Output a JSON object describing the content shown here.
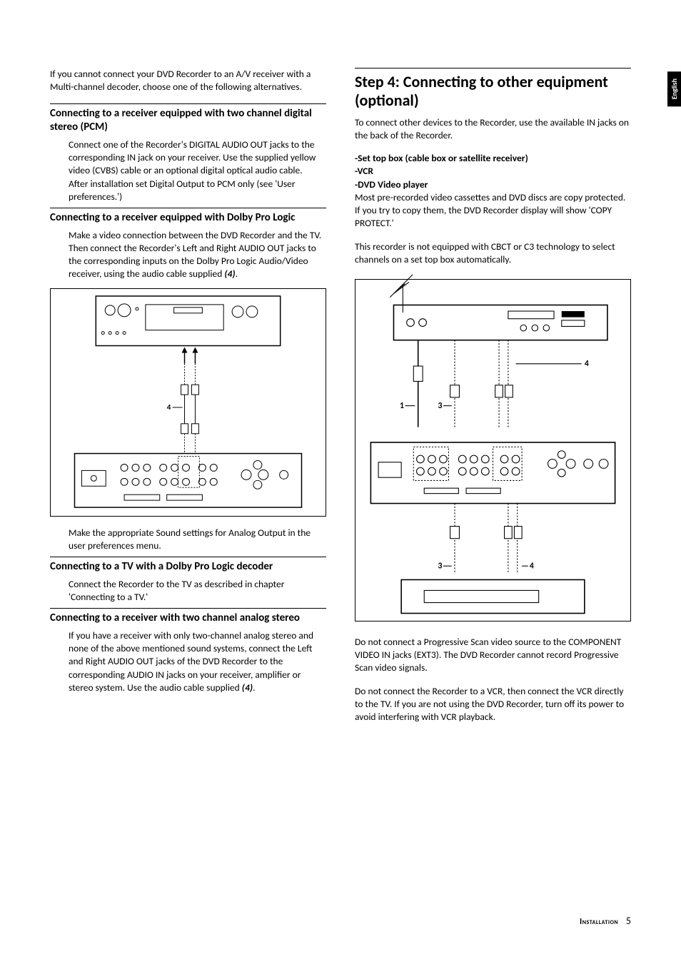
{
  "sideTab": "English",
  "left": {
    "intro": "If you cannot connect your DVD Recorder to an A/V receiver with a Multi-channel decoder, choose one of the following alternatives.",
    "sec1": {
      "title": "Connecting to a receiver equipped with two channel digital stereo (PCM)",
      "p1": "Connect one of the Recorder's DIGITAL AUDIO OUT jacks to the corresponding IN jack on your receiver. Use the supplied yellow video (CVBS) cable or an optional digital optical audio cable.",
      "p2": "After installation set Digital Output to PCM only (see 'User preferences.')"
    },
    "sec2": {
      "title": "Connecting to a receiver equipped with Dolby Pro Logic",
      "p1": "Make a video connection between the DVD Recorder and the TV.",
      "p2a": "Then connect the Recorder's Left and Right AUDIO OUT jacks to the corresponding inputs on the Dolby Pro Logic Audio/Video receiver, using the audio cable supplied ",
      "p2b": "(4)",
      "p2c": ".",
      "label4": "4",
      "p3": "Make the appropriate Sound settings for Analog Output in the user preferences menu."
    },
    "sec3": {
      "title": "Connecting to a TV with a Dolby Pro Logic decoder",
      "p1": "Connect the Recorder to the TV as described in chapter 'Connecting to a TV.'"
    },
    "sec4": {
      "title": "Connecting to a receiver with two channel analog stereo",
      "p1a": "If you have a receiver with only two-channel analog stereo and none of the above mentioned sound systems, connect the Left and Right AUDIO OUT jacks of the DVD Recorder to the corresponding AUDIO IN jacks on your receiver, amplifier or stereo system. Use the audio cable supplied ",
      "p1b": "(4)",
      "p1c": "."
    }
  },
  "right": {
    "stepTitle": "Step 4: Connecting to other equipment (optional)",
    "p1": "To connect other devices to the Recorder, use the available IN jacks on the back of the Recorder.",
    "list1": "-Set top box (cable box or satellite receiver)",
    "list2": "-VCR",
    "list3": "-DVD Video player",
    "p2": "Most pre-recorded video cassettes and DVD discs are copy protected. If you try to copy them, the DVD Recorder display will show 'COPY PROTECT.'",
    "p3": "This recorder is not equipped with CBCT or C3 technology to select channels on a set top box automatically.",
    "labels": {
      "l1": "1",
      "l3a": "3",
      "l4a": "4",
      "l3b": "3",
      "l4b": "4"
    },
    "p4": "Do not connect a Progressive Scan video source to the COMPONENT VIDEO IN jacks (EXT3). The DVD Recorder cannot record Progressive Scan video signals.",
    "p5": "Do not connect the Recorder to a VCR, then connect the VCR directly to the TV. If you are not using the DVD Recorder, turn off its power to avoid interfering with VCR playback."
  },
  "footer": {
    "section": "Installation",
    "page": "5"
  }
}
